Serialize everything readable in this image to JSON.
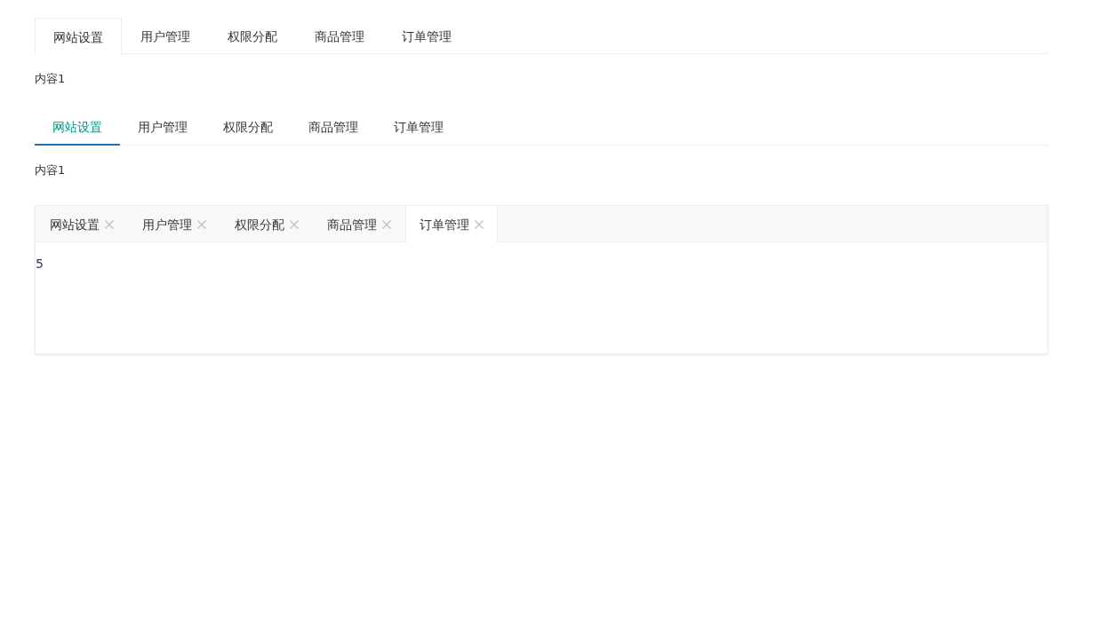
{
  "tab_groups": [
    {
      "kind": "plain",
      "tabs": [
        {
          "label": "网站设置",
          "selected": true
        },
        {
          "label": "用户管理",
          "selected": false
        },
        {
          "label": "权限分配",
          "selected": false
        },
        {
          "label": "商品管理",
          "selected": false
        },
        {
          "label": "订单管理",
          "selected": false
        }
      ],
      "content": "内容1"
    },
    {
      "kind": "underline",
      "tabs": [
        {
          "label": "网站设置",
          "selected": true
        },
        {
          "label": "用户管理",
          "selected": false
        },
        {
          "label": "权限分配",
          "selected": false
        },
        {
          "label": "商品管理",
          "selected": false
        },
        {
          "label": "订单管理",
          "selected": false
        }
      ],
      "content": "内容1"
    },
    {
      "kind": "card",
      "tabs": [
        {
          "label": "网站设置",
          "selected": false,
          "closable": true
        },
        {
          "label": "用户管理",
          "selected": false,
          "closable": true
        },
        {
          "label": "权限分配",
          "selected": false,
          "closable": true
        },
        {
          "label": "商品管理",
          "selected": false,
          "closable": true
        },
        {
          "label": "订单管理",
          "selected": true,
          "closable": true
        }
      ],
      "content": "5"
    }
  ]
}
